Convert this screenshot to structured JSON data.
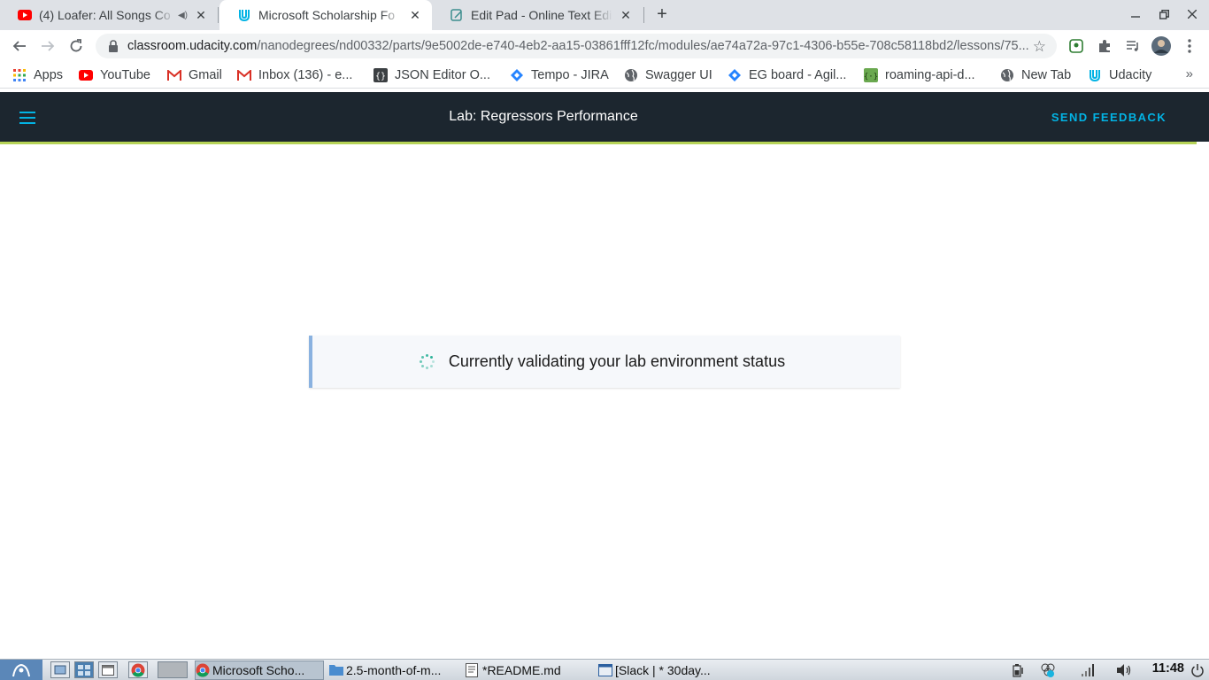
{
  "browser": {
    "tabs": [
      {
        "title": "(4) Loafer: All Songs Co",
        "icon": "youtube-icon",
        "audio": true
      },
      {
        "title": "Microsoft Scholarship Fo",
        "icon": "udacity-icon",
        "active": true
      },
      {
        "title": "Edit Pad - Online Text Edit",
        "icon": "editpad-icon"
      }
    ],
    "close_glyph": "✕",
    "new_tab_glyph": "+",
    "url": {
      "host": "classroom.udacity.com",
      "path": "/nanodegrees/nd00332/parts/9e5002de-e740-4eb2-aa15-03861fff12fc/modules/ae74a72a-97c1-4306-b55e-708c58118bd2/lessons/75..."
    },
    "bookmarks": [
      {
        "label": "Apps",
        "icon": "apps-grid-icon"
      },
      {
        "label": "YouTube",
        "icon": "youtube-icon"
      },
      {
        "label": "Gmail",
        "icon": "gmail-icon"
      },
      {
        "label": "Inbox (136) - e...",
        "icon": "gmail-icon"
      },
      {
        "label": "JSON Editor O...",
        "icon": "json-editor-icon"
      },
      {
        "label": "Tempo - JIRA",
        "icon": "jira-icon"
      },
      {
        "label": "Swagger UI",
        "icon": "globe-icon"
      },
      {
        "label": "EG board - Agil...",
        "icon": "jira-icon"
      },
      {
        "label": "roaming-api-d...",
        "icon": "api-icon"
      },
      {
        "label": "New Tab",
        "icon": "globe-icon"
      },
      {
        "label": "Udacity",
        "icon": "udacity-icon"
      }
    ],
    "bookmarks_more": "»"
  },
  "header": {
    "title": "Lab: Regressors Performance",
    "feedback_label": "SEND FEEDBACK"
  },
  "status": {
    "message": "Currently validating your lab environment status"
  },
  "taskbar": {
    "tasks": [
      {
        "label": "Microsoft Scho...",
        "icon": "chrome-icon",
        "active": true
      },
      {
        "label": "2.5-month-of-m...",
        "icon": "folder-icon"
      },
      {
        "label": "*README.md",
        "icon": "text-editor-icon"
      },
      {
        "label": "[Slack | * 30day...",
        "icon": "window-icon"
      }
    ],
    "clock": "11:48"
  },
  "colors": {
    "header_bg": "#1c262f",
    "accent_blue": "#02b3e4",
    "header_underline": "#b6d357",
    "status_border": "#8ab2e0",
    "spinner": "#2fb39a"
  }
}
